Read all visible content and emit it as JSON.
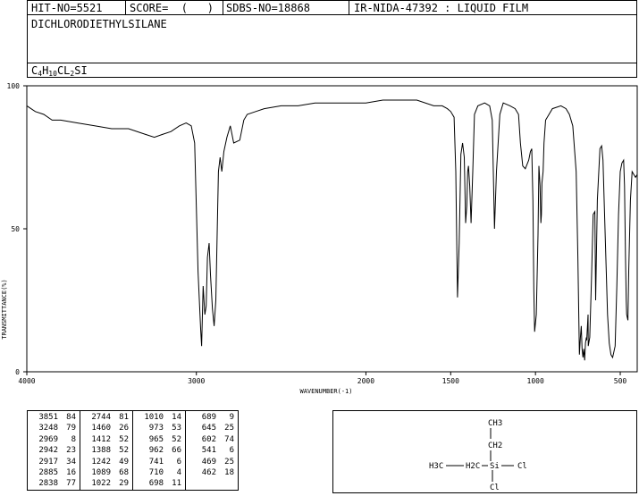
{
  "header": {
    "hit_no": "HIT-NO=5521",
    "score": "SCORE=  (   )",
    "sdbs_no": "SDBS-NO=18868",
    "method": "IR-NIDA-47392 : LIQUID FILM"
  },
  "compound": {
    "name": "DICHLORODIETHYLSILANE",
    "formula_parts": [
      "C",
      "4",
      "H",
      "10",
      "CL",
      "2",
      "SI"
    ]
  },
  "chart_data": {
    "type": "line",
    "title": "",
    "xlabel": "WAVENUMBER(-1)",
    "ylabel": "TRANSMITTANCE(%)",
    "xlim": [
      4000,
      400
    ],
    "ylim": [
      0,
      100
    ],
    "x_ticks": [
      4000,
      3000,
      2000,
      1500,
      1000,
      500
    ],
    "y_ticks": [
      0,
      50,
      100
    ],
    "grid": false,
    "series": [
      {
        "x": [
          4000,
          3950,
          3900,
          3851,
          3800,
          3700,
          3600,
          3500,
          3400,
          3300,
          3248,
          3200,
          3150,
          3100,
          3060,
          3030,
          3010,
          2990,
          2975,
          2969,
          2960,
          2950,
          2942,
          2935,
          2925,
          2917,
          2905,
          2895,
          2885,
          2870,
          2860,
          2850,
          2838,
          2820,
          2800,
          2780,
          2744,
          2720,
          2700,
          2650,
          2600,
          2500,
          2400,
          2300,
          2200,
          2100,
          2000,
          1900,
          1800,
          1700,
          1600,
          1550,
          1520,
          1500,
          1480,
          1470,
          1460,
          1450,
          1440,
          1430,
          1420,
          1412,
          1405,
          1400,
          1395,
          1388,
          1380,
          1370,
          1360,
          1340,
          1300,
          1270,
          1255,
          1242,
          1230,
          1210,
          1190,
          1150,
          1120,
          1100,
          1089,
          1075,
          1060,
          1040,
          1030,
          1022,
          1015,
          1010,
          1005,
          995,
          985,
          980,
          973,
          968,
          965,
          962,
          955,
          950,
          940,
          900,
          850,
          820,
          800,
          780,
          760,
          750,
          741,
          735,
          730,
          725,
          720,
          715,
          710,
          705,
          700,
          698,
          690,
          689,
          680,
          670,
          660,
          650,
          645,
          635,
          620,
          610,
          602,
          595,
          585,
          575,
          565,
          555,
          545,
          541,
          530,
          520,
          510,
          500,
          490,
          480,
          475,
          469,
          465,
          462,
          455,
          450,
          440,
          430,
          420,
          410,
          400
        ],
        "y": [
          93,
          91,
          90,
          88,
          88,
          87,
          86,
          85,
          85,
          83,
          82,
          83,
          84,
          86,
          87,
          86,
          80,
          35,
          15,
          9,
          30,
          20,
          23,
          40,
          45,
          34,
          22,
          16,
          25,
          70,
          75,
          70,
          77,
          82,
          86,
          80,
          81,
          88,
          90,
          91,
          92,
          93,
          93,
          94,
          94,
          94,
          94,
          95,
          95,
          95,
          93,
          93,
          92,
          91,
          89,
          70,
          26,
          45,
          76,
          80,
          75,
          52,
          58,
          70,
          72,
          65,
          52,
          70,
          90,
          93,
          94,
          93,
          88,
          50,
          70,
          90,
          94,
          93,
          92,
          90,
          80,
          72,
          71,
          74,
          77,
          78,
          60,
          29,
          14,
          20,
          48,
          72,
          65,
          52,
          55,
          66,
          70,
          80,
          88,
          92,
          93,
          92,
          90,
          86,
          70,
          40,
          6,
          12,
          16,
          8,
          5,
          8,
          4,
          10,
          12,
          11,
          20,
          9,
          12,
          32,
          55,
          56,
          25,
          60,
          78,
          79,
          74,
          60,
          40,
          20,
          10,
          6,
          5,
          6,
          9,
          30,
          55,
          70,
          73,
          74,
          65,
          40,
          25,
          20,
          18,
          35,
          60,
          70,
          69,
          68,
          69
        ]
      }
    ]
  },
  "peak_table": [
    [
      [
        "3851",
        "84"
      ],
      [
        "3248",
        "79"
      ],
      [
        "2969",
        "8"
      ],
      [
        "2942",
        "23"
      ],
      [
        "2917",
        "34"
      ],
      [
        "2885",
        "16"
      ],
      [
        "2838",
        "77"
      ]
    ],
    [
      [
        "2744",
        "81"
      ],
      [
        "1460",
        "26"
      ],
      [
        "1412",
        "52"
      ],
      [
        "1388",
        "52"
      ],
      [
        "1242",
        "49"
      ],
      [
        "1089",
        "68"
      ],
      [
        "1022",
        "29"
      ]
    ],
    [
      [
        "1010",
        "14"
      ],
      [
        "973",
        "53"
      ],
      [
        "965",
        "52"
      ],
      [
        "962",
        "66"
      ],
      [
        "741",
        "6"
      ],
      [
        "710",
        "4"
      ],
      [
        "698",
        "11"
      ]
    ],
    [
      [
        "689",
        "9"
      ],
      [
        "645",
        "25"
      ],
      [
        "602",
        "74"
      ],
      [
        "541",
        "6"
      ],
      [
        "469",
        "25"
      ],
      [
        "462",
        "18"
      ]
    ]
  ],
  "structure": {
    "ch3_top": "CH3",
    "ch2_top": "CH2",
    "h3c_left": "H3C",
    "h2c_left": "H2C",
    "si": "Si",
    "cl_right": "Cl",
    "cl_bottom": "Cl"
  }
}
